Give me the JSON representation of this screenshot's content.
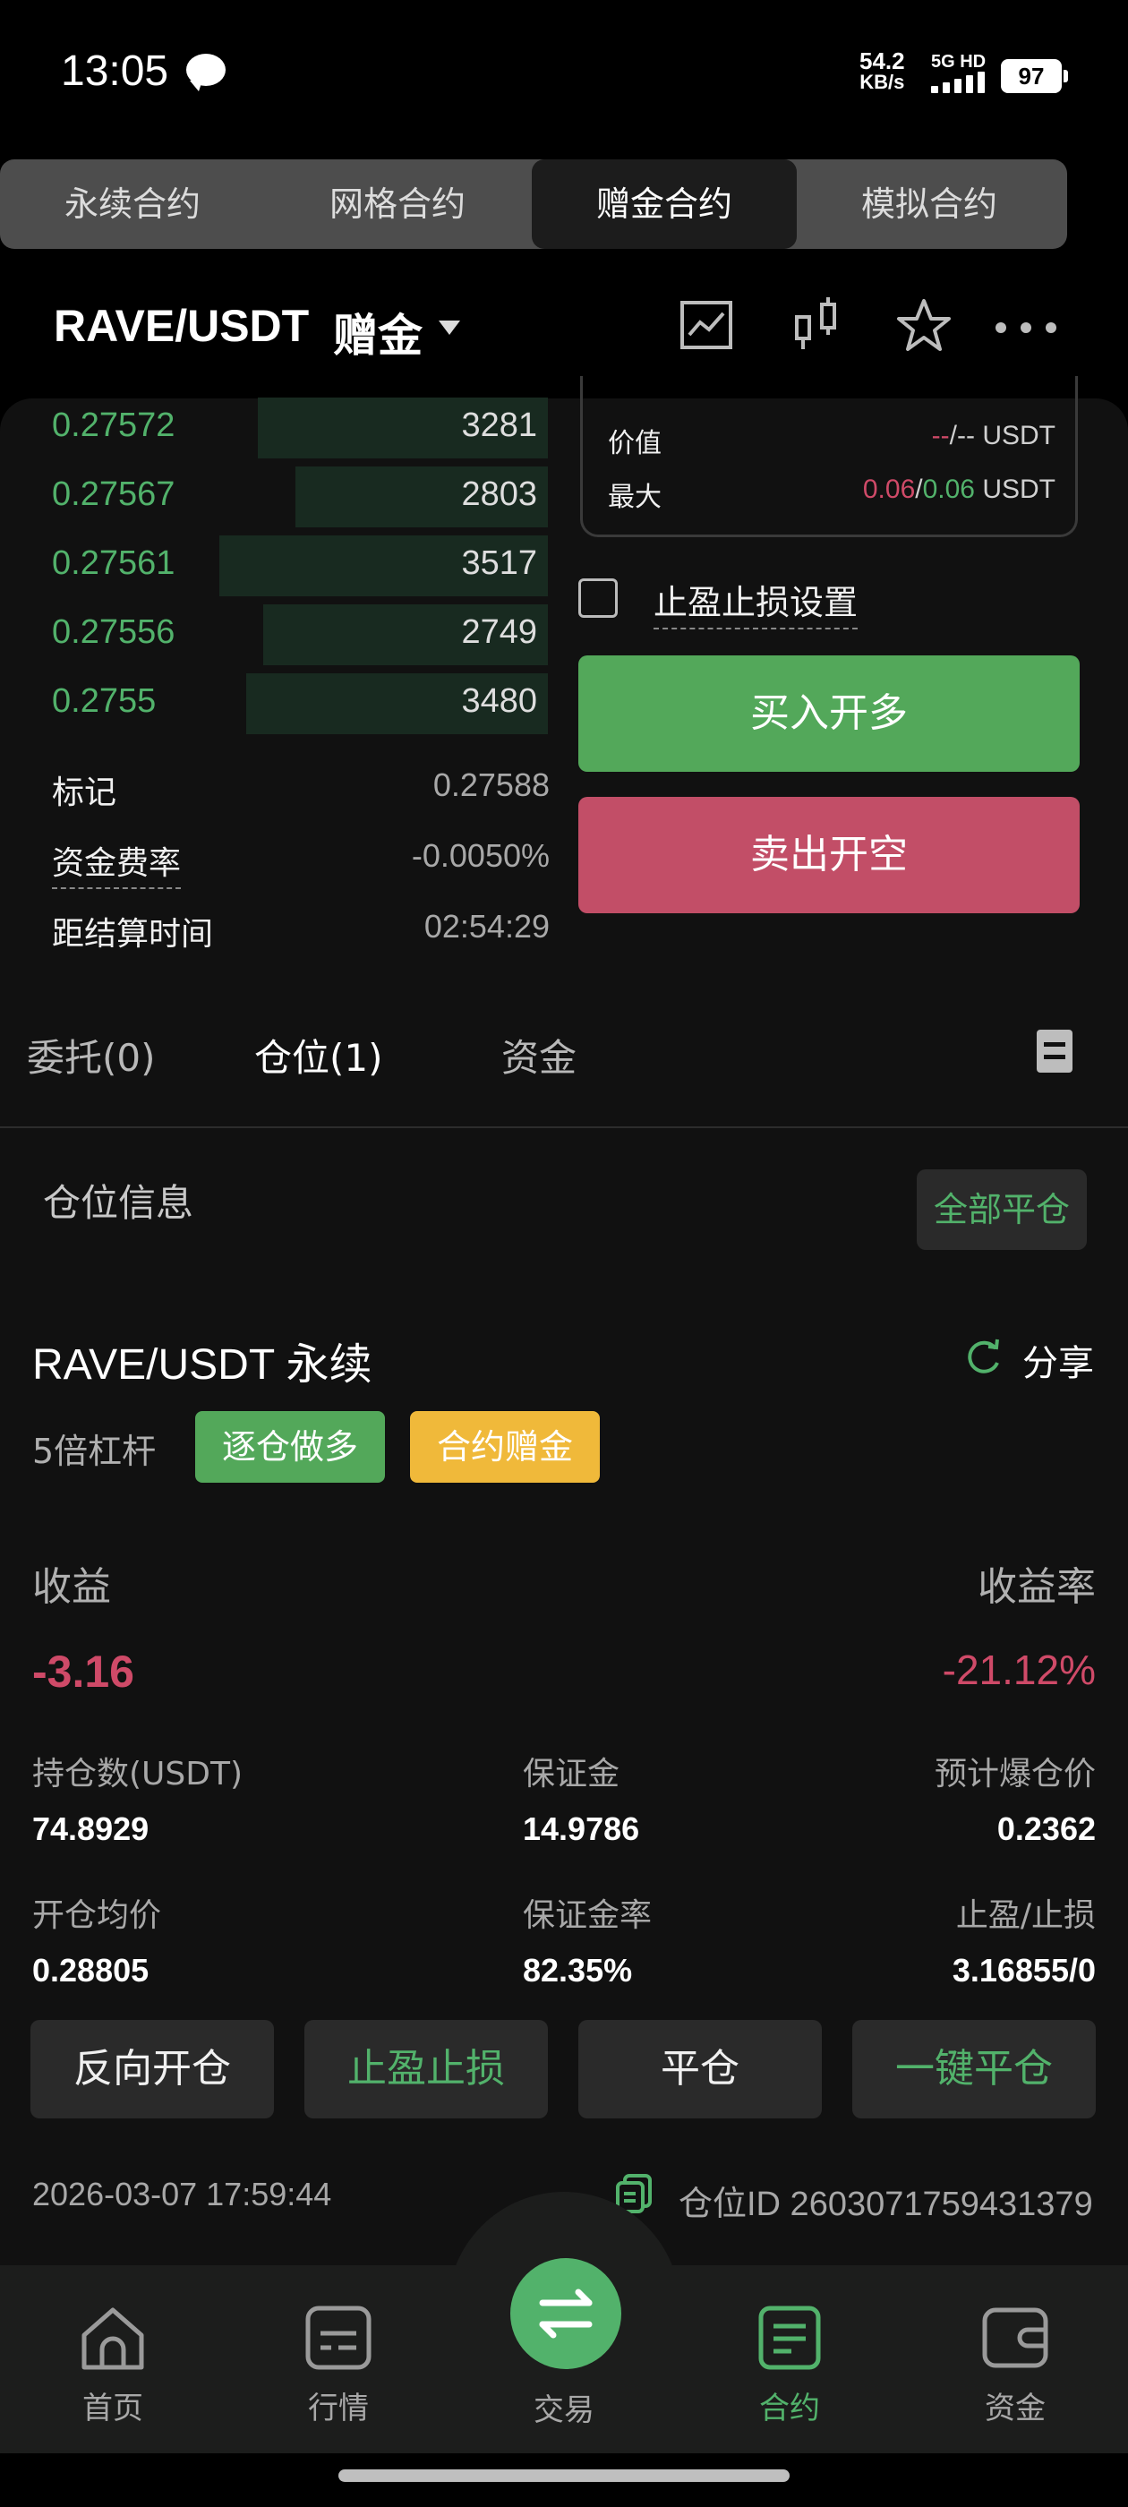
{
  "status_bar": {
    "time": "13:05",
    "net_speed_value": "54.2",
    "net_speed_unit": "KB/s",
    "signal": "5G HD",
    "battery": "97"
  },
  "top_tabs": [
    "永续合约",
    "网格合约",
    "赠金合约",
    "模拟合约"
  ],
  "header": {
    "pair": "RAVE/USDT",
    "pair_type": "赠金"
  },
  "icons": {
    "chart": "line-chart-icon",
    "kline": "candlestick-icon",
    "favorite": "star-icon",
    "more": "more-dots-icon"
  },
  "orderbook": [
    {
      "price": "0.27572",
      "qty": "3281",
      "depth": 0.53
    },
    {
      "price": "0.27567",
      "qty": "2803",
      "depth": 0.46
    },
    {
      "price": "0.27561",
      "qty": "3517",
      "depth": 0.6
    },
    {
      "price": "0.27556",
      "qty": "2749",
      "depth": 0.52
    },
    {
      "price": "0.2755",
      "qty": "3480",
      "depth": 0.55
    }
  ],
  "market_info": {
    "mark_label": "标记",
    "mark_value": "0.27588",
    "funding_label": "资金费率",
    "funding_value": "-0.0050%",
    "settle_label": "距结算时间",
    "settle_value": "02:54:29"
  },
  "order_panel": {
    "value_label": "价值",
    "value_a": "--",
    "value_b": "--",
    "value_unit": "USDT",
    "max_label": "最大",
    "max_a": "0.06",
    "max_b": "0.06",
    "max_unit": "USDT",
    "tpsl_label": "止盈止损设置",
    "buy_label": "买入开多",
    "sell_label": "卖出开空"
  },
  "order_tabs": {
    "orders": "委托(0)",
    "positions": "仓位(1)",
    "funds": "资金"
  },
  "positions": {
    "section_title": "仓位信息",
    "close_all": "全部平仓",
    "symbol": "RAVE/USDT 永续",
    "share": "分享",
    "leverage": "5倍杠杆",
    "tag_side": "逐仓做多",
    "tag_bonus": "合约赠金",
    "pnl_label": "收益",
    "pnl_value": "-3.16",
    "roi_label": "收益率",
    "roi_value": "-21.12%",
    "size_label": "持仓数(USDT)",
    "size_value": "74.8929",
    "margin_label": "保证金",
    "margin_value": "14.9786",
    "liq_label": "预计爆仓价",
    "liq_value": "0.2362",
    "entry_label": "开仓均价",
    "entry_value": "0.28805",
    "margin_rate_label": "保证金率",
    "margin_rate_value": "82.35%",
    "tpsl_label": "止盈/止损",
    "tpsl_value": "3.16855/0",
    "btn_reverse": "反向开仓",
    "btn_tpsl": "止盈止损",
    "btn_close": "平仓",
    "btn_quick_close": "一键平仓",
    "timestamp": "2026-03-07 17:59:44",
    "position_id": "仓位ID 2603071759431379"
  },
  "bottom_nav": [
    "首页",
    "行情",
    "交易",
    "合约",
    "资金"
  ],
  "colors": {
    "green": "#52b26b",
    "red": "#cf4a68",
    "bonus": "#f0b93a",
    "buy": "#53a85a",
    "sell": "#c24e67"
  }
}
